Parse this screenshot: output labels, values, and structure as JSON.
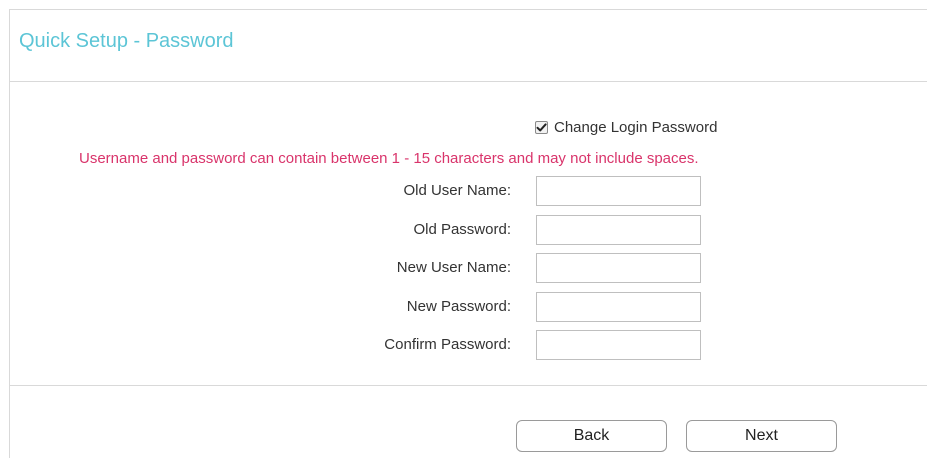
{
  "header": {
    "title": "Quick Setup - Password"
  },
  "change_password": {
    "label": "Change Login Password",
    "checked": true
  },
  "notice": "Username and password can contain between 1 - 15 characters and may not include spaces.",
  "form": {
    "fields": [
      {
        "label": "Old User Name:",
        "value": ""
      },
      {
        "label": "Old Password:",
        "value": ""
      },
      {
        "label": "New User Name:",
        "value": ""
      },
      {
        "label": "New Password:",
        "value": ""
      },
      {
        "label": "Confirm Password:",
        "value": ""
      }
    ]
  },
  "buttons": {
    "back_label": "Back",
    "next_label": "Next"
  },
  "colors": {
    "title": "#5cc5d6",
    "notice": "#d9346b",
    "border": "#d9d9d9"
  }
}
